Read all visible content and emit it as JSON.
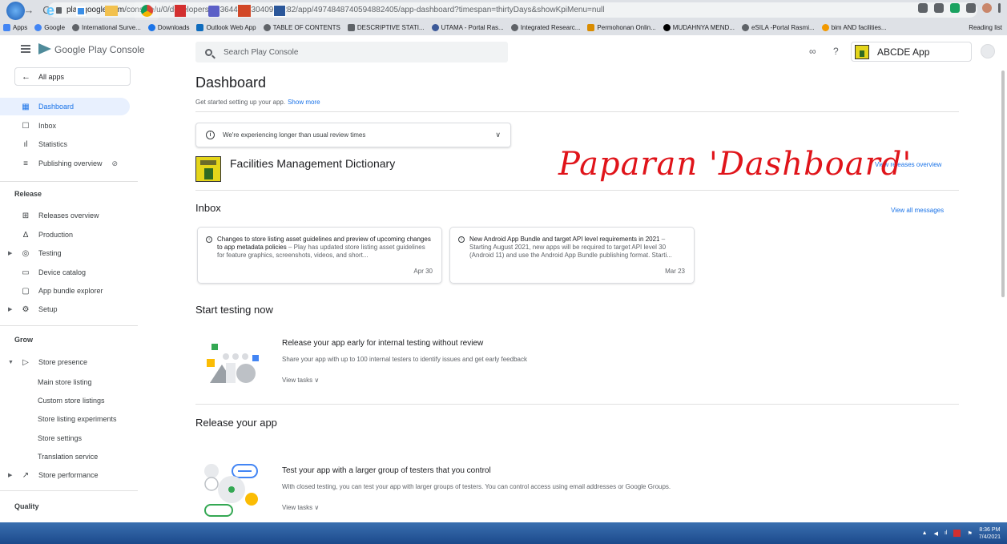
{
  "browser": {
    "url_host": "play.google.com",
    "url_path": "/console/u/0/developers/7736446023040938282/app/4974848740594882405/app-dashboard?timespan=thirtyDays&showKpiMenu=null",
    "bookmarks": [
      "Apps",
      "Google",
      "International Surve...",
      "Downloads",
      "Outlook Web App",
      "TABLE OF CONTENTS",
      "DESCRIPTIVE STATI...",
      "UTAMA - Portal Ras...",
      "Integrated Researc...",
      "Permohonan Onlin...",
      "MUDAHNYA MEND...",
      "eSILA -Portal Rasmi...",
      "bim AND facilities..."
    ],
    "reading_list": "Reading list"
  },
  "header": {
    "brand": "Google Play Console",
    "search_placeholder": "Search Play Console",
    "app_name": "ABCDE App"
  },
  "sidebar": {
    "all_apps": "All apps",
    "items": [
      {
        "label": "Dashboard",
        "icon": "dashboard-icon"
      },
      {
        "label": "Inbox",
        "icon": "inbox-icon"
      },
      {
        "label": "Statistics",
        "icon": "bar-chart-icon"
      },
      {
        "label": "Publishing overview",
        "icon": "publish-icon"
      }
    ],
    "release_label": "Release",
    "release_items": [
      {
        "label": "Releases overview",
        "icon": "grid-icon"
      },
      {
        "label": "Production",
        "icon": "production-icon"
      },
      {
        "label": "Testing",
        "icon": "testing-icon"
      },
      {
        "label": "Device catalog",
        "icon": "device-icon"
      },
      {
        "label": "App bundle explorer",
        "icon": "bundle-icon"
      },
      {
        "label": "Setup",
        "icon": "gear-icon"
      }
    ],
    "grow_label": "Grow",
    "grow_items": [
      {
        "label": "Store presence",
        "icon": "play-outline-icon"
      },
      {
        "label": "Main store listing"
      },
      {
        "label": "Custom store listings"
      },
      {
        "label": "Store listing experiments"
      },
      {
        "label": "Store settings"
      },
      {
        "label": "Translation service"
      },
      {
        "label": "Store performance",
        "icon": "trend-icon"
      }
    ],
    "quality_label": "Quality"
  },
  "main": {
    "title": "Dashboard",
    "subtitle": "Get started setting up your app.",
    "show_more": "Show more",
    "notice": "We're experiencing longer than usual review times",
    "app_title": "Facilities Management Dictionary",
    "view_releases": "View releases overview",
    "annotation": "Paparan 'Dashboard'",
    "inbox_title": "Inbox",
    "view_all_messages": "View all messages",
    "messages": [
      {
        "title": "Changes to store listing asset guidelines and preview of upcoming changes to app metadata policies",
        "body": " – Play has updated store listing asset guidelines for feature graphics, screenshots, videos, and short...",
        "date": "Apr 30"
      },
      {
        "title": "New Android App Bundle and target API level requirements in 2021",
        "body": " – Starting August 2021, new apps will be required to target API level 30 (Android 11) and use the Android App Bundle publishing format. Starti...",
        "date": "Mar 23"
      }
    ],
    "testing_title": "Start testing now",
    "testing_task": {
      "title": "Release your app early for internal testing without review",
      "desc": "Share your app with up to 100 internal testers to identify issues and get early feedback",
      "link": "View tasks"
    },
    "release_title": "Release your app",
    "release_task": {
      "title": "Test your app with a larger group of testers that you control",
      "desc": "With closed testing, you can test your app with larger groups of testers. You can control access using email addresses or Google Groups.",
      "link": "View tasks"
    }
  },
  "taskbar": {
    "time": "8:36 PM",
    "date": "7/4/2021"
  },
  "colors": {
    "accent": "#1a73e8",
    "annotation": "#e0141a"
  }
}
